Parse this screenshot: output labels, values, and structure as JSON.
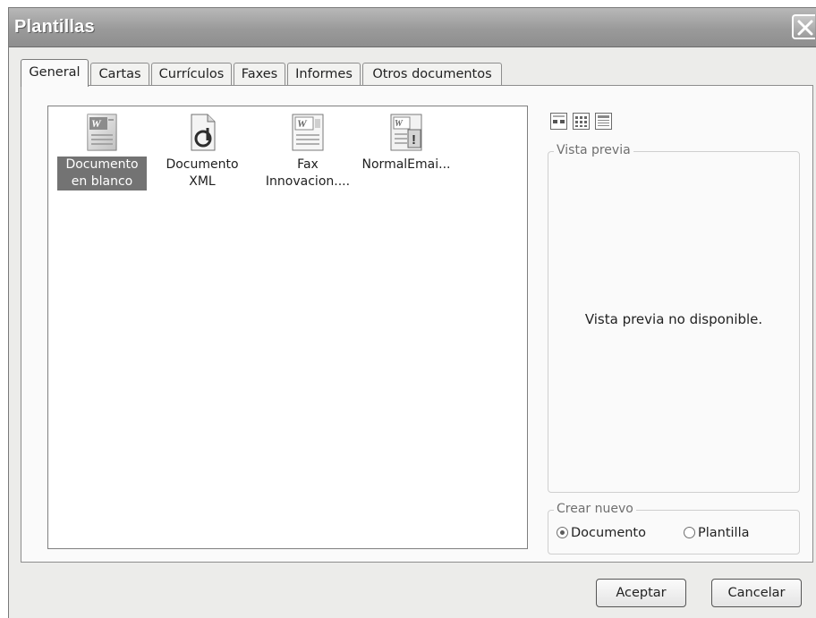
{
  "dialog": {
    "title": "Plantillas",
    "close_icon": "close-icon"
  },
  "tabs": [
    {
      "label": "General",
      "active": true
    },
    {
      "label": "Cartas"
    },
    {
      "label": "Currículos"
    },
    {
      "label": "Faxes"
    },
    {
      "label": "Informes"
    },
    {
      "label": "Otros documentos"
    }
  ],
  "templates": [
    {
      "label": "Documento en blanco",
      "icon": "word-document-icon",
      "selected": true
    },
    {
      "label": "Documento XML",
      "icon": "xml-document-icon"
    },
    {
      "label": "Fax Innovacion....",
      "icon": "word-template-icon"
    },
    {
      "label": "NormalEmai...",
      "icon": "email-template-icon"
    }
  ],
  "view_buttons": [
    {
      "icon": "large-icons-view-icon"
    },
    {
      "icon": "list-view-icon"
    },
    {
      "icon": "details-view-icon"
    }
  ],
  "preview": {
    "group_label": "Vista previa",
    "message": "Vista previa no disponible."
  },
  "create_new": {
    "group_label": "Crear nuevo",
    "options": [
      {
        "label": "Documento",
        "checked": true
      },
      {
        "label": "Plantilla",
        "checked": false
      }
    ]
  },
  "buttons": {
    "ok": "Aceptar",
    "cancel": "Cancelar"
  }
}
